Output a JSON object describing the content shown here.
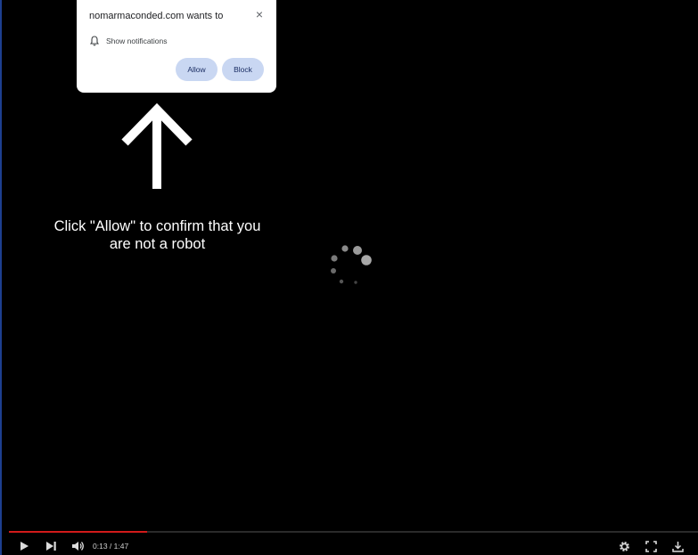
{
  "popup": {
    "title": "nomarmaconded.com wants to",
    "permission": "Show notifications",
    "allow_label": "Allow",
    "block_label": "Block",
    "icons": {
      "close": "close-icon",
      "permission": "bell-icon"
    }
  },
  "overlay": {
    "message": "Click \"Allow\" to confirm that you are not a robot",
    "arrow_icon": "arrow-up-icon",
    "spinner_icon": "loading-spinner-icon"
  },
  "player": {
    "time_display": "0:13 / 1:47",
    "progress": 0.2,
    "progress_color": "#d11a1a",
    "icons": [
      "play-icon",
      "next-icon",
      "volume-icon",
      "settings-icon",
      "fullscreen-icon",
      "download-icon"
    ]
  }
}
